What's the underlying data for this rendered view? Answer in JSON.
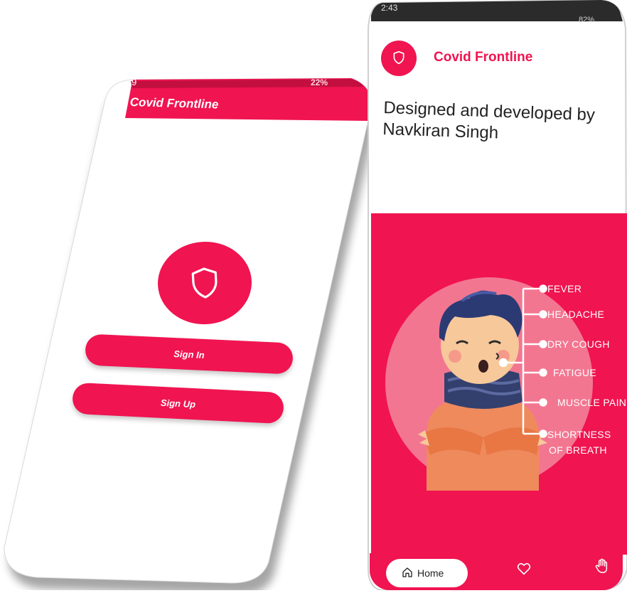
{
  "colors": {
    "accent": "#f01450",
    "accent_light": "#f37691",
    "background": "#ffffff"
  },
  "left_phone": {
    "status_time": "9",
    "status_right": "22%",
    "app_title": "Covid Frontline",
    "logo_icon": "shield-icon",
    "buttons": {
      "sign_in": "Sign In",
      "sign_up": "Sign Up"
    }
  },
  "right_phone": {
    "status_time": "2:43",
    "status_right": "82%",
    "header": {
      "logo_icon": "shield-icon",
      "app_name": "Covid Frontline"
    },
    "credit": "Designed and developed by Navkiran Singh",
    "symptoms": [
      "FEVER",
      "HEADACHE",
      "DRY COUGH",
      "FATIGUE",
      "MUSCLE PAIN",
      "SHORTNESS",
      "OF BREATH"
    ],
    "bottom_nav": {
      "home_label": "Home",
      "home_icon": "home-icon",
      "favorites_icon": "heart-icon",
      "help_icon": "hand-icon"
    }
  }
}
